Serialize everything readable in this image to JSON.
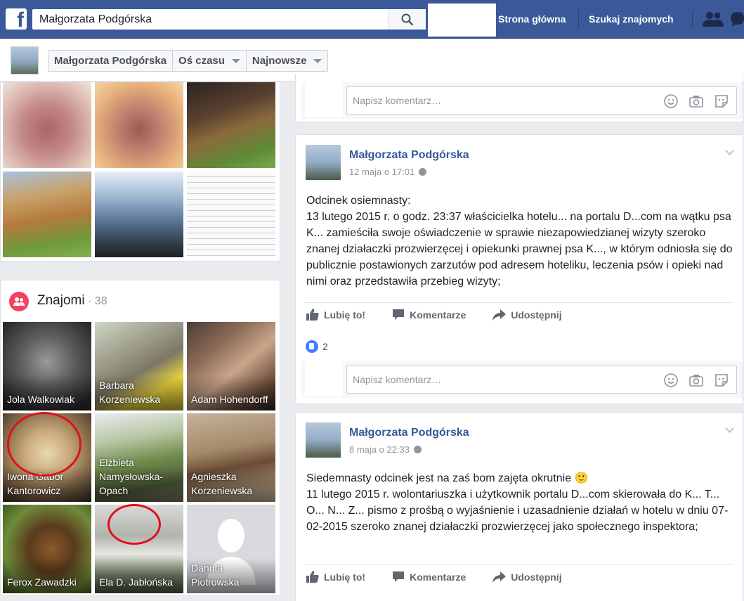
{
  "topbar": {
    "logo": "f",
    "search_value": "Małgorzata Podgórska",
    "nav_home": "Strona główna",
    "nav_find_friends": "Szukaj znajomych"
  },
  "subheader": {
    "crumbs": [
      "Małgorzata Podgórska",
      "Oś czasu",
      "Najnowsze"
    ]
  },
  "friends": {
    "title": "Znajomi",
    "separator": " · ",
    "count": "38",
    "items": [
      {
        "name": "Jola Walkowiak"
      },
      {
        "name": "Barbara Korzeniewska"
      },
      {
        "name": "Adam Hohendorff"
      },
      {
        "name": "Iwona Gabor Kantorowicz"
      },
      {
        "name": "Elżbieta Namysłowska-Opach"
      },
      {
        "name": "Agnieszka Korzeniewska"
      },
      {
        "name": "Ferox Zawadzki"
      },
      {
        "name": "Ela D. Jabłońska"
      },
      {
        "name": "Danuta Piotrowska"
      }
    ]
  },
  "comment_placeholder": "Napisz komentarz…",
  "actions": {
    "like": "Lubię to!",
    "comment": "Komentarze",
    "share": "Udostępnij"
  },
  "posts": [
    {
      "author": "Małgorzata Podgórska",
      "time": "12 maja o 17:01",
      "text": "Odcinek osiemnasty:\n13 lutego 2015 r. o godz. 23:37 właścicielka hotelu... na portalu D...com na wątku psa K... zamieściła swoje oświadczenie w sprawie niezapowiedzianej wizyty szeroko znanej działaczki prozwierzęcej i opiekunki prawnej psa K..., w którym odniosła się do publicznie postawionych zarzutów pod adresem hoteliku, leczenia psów i opieki nad nimi oraz przedstawiła przebieg wizyty;",
      "likes": "2"
    },
    {
      "author": "Małgorzata Podgórska",
      "time": "8 maja o 22:33",
      "text": "Siedemnasty odcinek jest na zaś bom zajęta okrutnie 🙂\n11 lutego 2015 r. wolontariuszka i użytkownik portalu D...com skierowała do K... T... O... N... Z... pismo z prośbą o wyjaśnienie i uzasadnienie działań w hotelu w dniu 07-02-2015 szeroko znanej działaczki prozwierzęcej jako społecznego inspektora;"
    }
  ],
  "colors": {
    "brand_blue": "#3b5998",
    "link_blue": "#365899",
    "friends_pink": "#f3425f",
    "annotation_red": "#e0101a"
  }
}
